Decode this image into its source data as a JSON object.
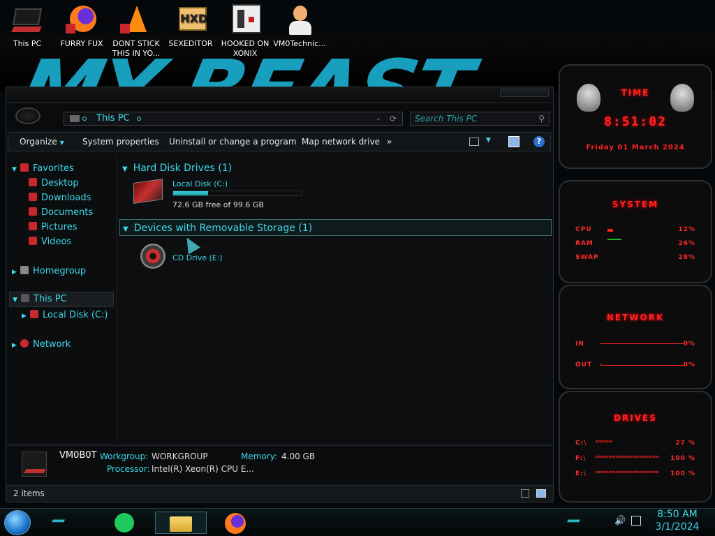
{
  "desktop": {
    "wallpaper_text": "MY BEAST",
    "icons": [
      {
        "label": "This PC"
      },
      {
        "label": "FURRY FUX"
      },
      {
        "label": "DONT STICK THIS IN YO..."
      },
      {
        "label": "SEXEDITOR"
      },
      {
        "label": "HOOKED ON XONIX"
      },
      {
        "label": "VM0Technic..."
      }
    ]
  },
  "explorer": {
    "address": "This PC",
    "search_placeholder": "Search This PC",
    "toolbar": {
      "organize": "Organize",
      "system_properties": "System properties",
      "uninstall": "Uninstall or change a program",
      "map_drive": "Map network drive",
      "more": "»"
    },
    "nav": {
      "favorites": "Favorites",
      "desktop": "Desktop",
      "downloads": "Downloads",
      "documents": "Documents",
      "pictures": "Pictures",
      "videos": "Videos",
      "homegroup": "Homegroup",
      "this_pc": "This PC",
      "local_disk": "Local Disk (C:)",
      "network": "Network"
    },
    "groups": {
      "hdd": "Hard Disk Drives (1)",
      "removable": "Devices with Removable Storage (1)"
    },
    "drives": {
      "c_label": "Local Disk (C:)",
      "c_free": "72.6 GB free of 99.6 GB",
      "c_used_fraction": 0.27,
      "cd_label": "CD Drive (E:)"
    },
    "details": {
      "computer_name": "VM0B0T",
      "workgroup_label": "Workgroup:",
      "workgroup_value": "WORKGROUP",
      "memory_label": "Memory:",
      "memory_value": "4.00 GB",
      "processor_label": "Processor:",
      "processor_value": "Intel(R) Xeon(R) CPU E..."
    },
    "status": "2 items"
  },
  "gadgets": {
    "time": {
      "title": "TIME",
      "clock": "8:51:02",
      "date": "Friday 01 March 2024"
    },
    "system": {
      "title": "SYSTEM",
      "cpu_label": "CPU",
      "cpu": "12%",
      "ram_label": "RAM",
      "ram": "26%",
      "swap_label": "SWAP",
      "swap": "28%"
    },
    "network": {
      "title": "NETWORK",
      "in_label": "IN",
      "in": "0%",
      "out_label": "OUT",
      "out": "0%"
    },
    "drives": {
      "title": "DRIVES",
      "c_label": "C:\\",
      "c": "27 %",
      "f_label": "F:\\",
      "f": "100 %",
      "e_label": "E:\\",
      "e": "100 %"
    }
  },
  "taskbar": {
    "time": "8:50 AM",
    "date": "3/1/2024"
  },
  "colors": {
    "accent_cyan": "#3fd8e8",
    "alert_red": "#ff2222"
  }
}
